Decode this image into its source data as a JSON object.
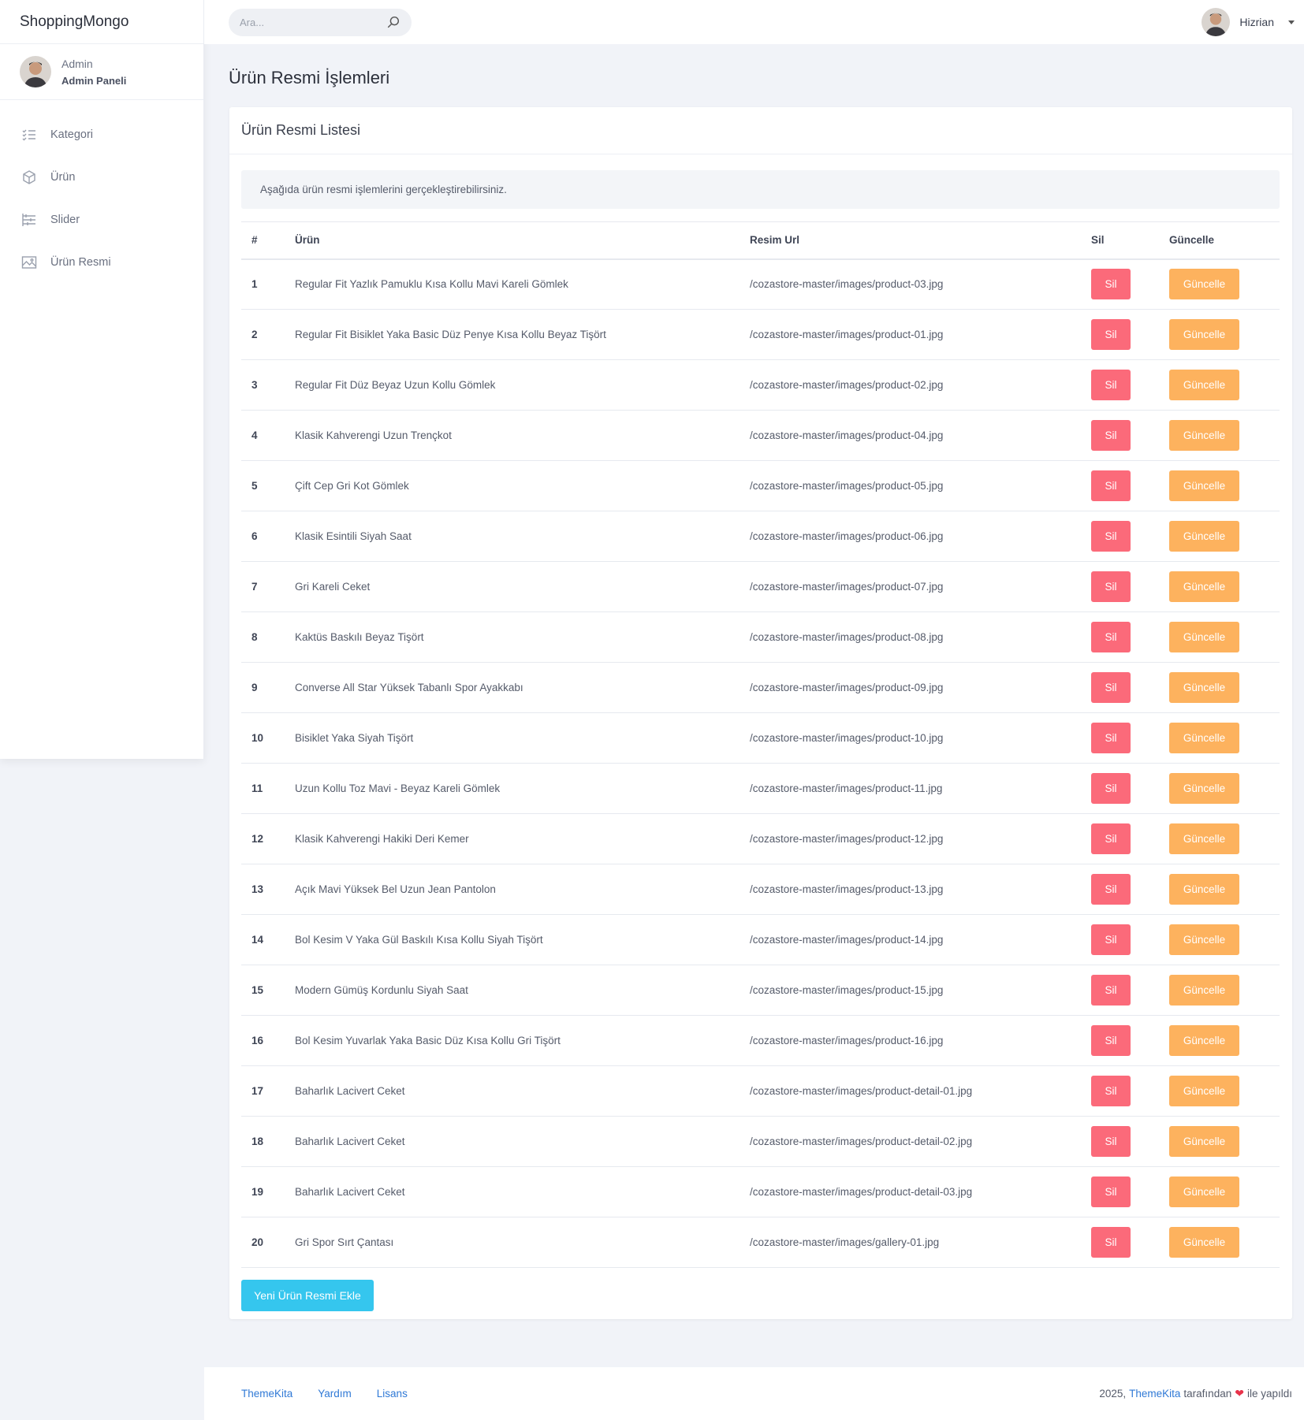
{
  "sidebar": {
    "brand": "ShoppingMongo",
    "user_role": "Admin",
    "user_panel": "Admin Paneli",
    "items": [
      {
        "label": "Kategori",
        "icon": "list-icon"
      },
      {
        "label": "Ürün",
        "icon": "box-icon"
      },
      {
        "label": "Slider",
        "icon": "slider-icon"
      },
      {
        "label": "Ürün Resmi",
        "icon": "image-icon"
      }
    ]
  },
  "topbar": {
    "search_placeholder": "Ara...",
    "user_name": "Hizrian"
  },
  "main": {
    "page_title": "Ürün Resmi İşlemleri",
    "card_title": "Ürün Resmi Listesi",
    "info_text": "Aşağıda ürün resmi işlemlerini gerçekleştirebilirsiniz.",
    "columns": [
      "#",
      "Ürün",
      "Resim Url",
      "Sil",
      "Güncelle"
    ],
    "delete_label": "Sil",
    "update_label": "Güncelle",
    "rows": [
      {
        "num": "1",
        "product": "Regular Fit Yazlık Pamuklu Kısa Kollu Mavi Kareli Gömlek",
        "url": "/cozastore-master/images/product-03.jpg"
      },
      {
        "num": "2",
        "product": "Regular Fit Bisiklet Yaka Basic Düz Penye Kısa Kollu Beyaz Tişört",
        "url": "/cozastore-master/images/product-01.jpg"
      },
      {
        "num": "3",
        "product": "Regular Fit Düz Beyaz Uzun Kollu Gömlek",
        "url": "/cozastore-master/images/product-02.jpg"
      },
      {
        "num": "4",
        "product": "Klasik Kahverengi Uzun Trençkot",
        "url": "/cozastore-master/images/product-04.jpg"
      },
      {
        "num": "5",
        "product": "Çift Cep Gri Kot Gömlek",
        "url": "/cozastore-master/images/product-05.jpg"
      },
      {
        "num": "6",
        "product": "Klasik Esintili Siyah Saat",
        "url": "/cozastore-master/images/product-06.jpg"
      },
      {
        "num": "7",
        "product": "Gri Kareli Ceket",
        "url": "/cozastore-master/images/product-07.jpg"
      },
      {
        "num": "8",
        "product": "Kaktüs Baskılı Beyaz Tişört",
        "url": "/cozastore-master/images/product-08.jpg"
      },
      {
        "num": "9",
        "product": "Converse All Star Yüksek Tabanlı Spor Ayakkabı",
        "url": "/cozastore-master/images/product-09.jpg"
      },
      {
        "num": "10",
        "product": "Bisiklet Yaka Siyah Tişört",
        "url": "/cozastore-master/images/product-10.jpg"
      },
      {
        "num": "11",
        "product": "Uzun Kollu Toz Mavi - Beyaz Kareli Gömlek",
        "url": "/cozastore-master/images/product-11.jpg"
      },
      {
        "num": "12",
        "product": "Klasik Kahverengi Hakiki Deri Kemer",
        "url": "/cozastore-master/images/product-12.jpg"
      },
      {
        "num": "13",
        "product": "Açık Mavi Yüksek Bel Uzun Jean Pantolon",
        "url": "/cozastore-master/images/product-13.jpg"
      },
      {
        "num": "14",
        "product": "Bol Kesim V Yaka Gül Baskılı Kısa Kollu Siyah Tişört",
        "url": "/cozastore-master/images/product-14.jpg"
      },
      {
        "num": "15",
        "product": "Modern Gümüş Kordunlu Siyah Saat",
        "url": "/cozastore-master/images/product-15.jpg"
      },
      {
        "num": "16",
        "product": "Bol Kesim Yuvarlak Yaka Basic Düz Kısa Kollu Gri Tişört",
        "url": "/cozastore-master/images/product-16.jpg"
      },
      {
        "num": "17",
        "product": "Baharlık Lacivert Ceket",
        "url": "/cozastore-master/images/product-detail-01.jpg"
      },
      {
        "num": "18",
        "product": "Baharlık Lacivert Ceket",
        "url": "/cozastore-master/images/product-detail-02.jpg"
      },
      {
        "num": "19",
        "product": "Baharlık Lacivert Ceket",
        "url": "/cozastore-master/images/product-detail-03.jpg"
      },
      {
        "num": "20",
        "product": "Gri Spor Sırt Çantası",
        "url": "/cozastore-master/images/gallery-01.jpg"
      }
    ],
    "add_button": "Yeni Ürün Resmi Ekle"
  },
  "footer": {
    "links": [
      "ThemeKita",
      "Yardım",
      "Lisans"
    ],
    "credit_year": "2025,",
    "credit_brand": "ThemeKita",
    "credit_by": "tarafından",
    "credit_made": "ile yapıldı"
  },
  "colors": {
    "delete": "#fb6a7a",
    "update": "#fdb25e",
    "add": "#35c6ee",
    "link": "#2f79d6"
  }
}
